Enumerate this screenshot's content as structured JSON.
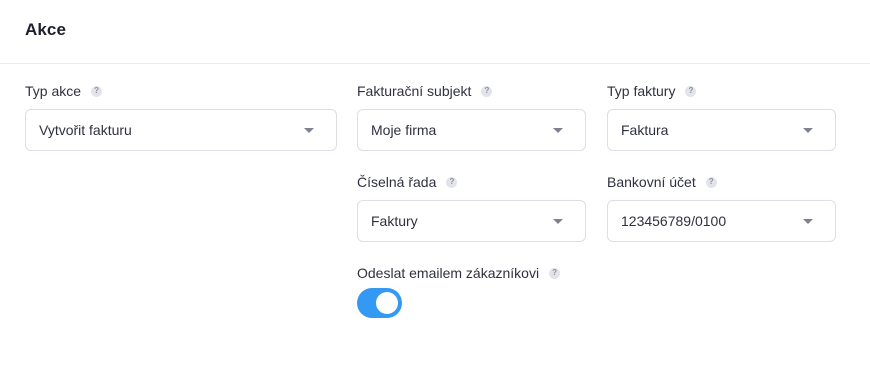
{
  "header": {
    "title": "Akce"
  },
  "fields": {
    "typ_akce": {
      "label": "Typ akce",
      "value": "Vytvořit fakturu",
      "help": "?"
    },
    "fakturacni_subjekt": {
      "label": "Fakturační subjekt",
      "value": "Moje firma",
      "help": "?"
    },
    "typ_faktury": {
      "label": "Typ faktury",
      "value": "Faktura",
      "help": "?"
    },
    "ciselna_rada": {
      "label": "Číselná řada",
      "value": "Faktury",
      "help": "?"
    },
    "bankovni_ucet": {
      "label": "Bankovní účet",
      "value": "123456789/0100",
      "help": "?"
    },
    "odeslat_emailem": {
      "label": "Odeslat emailem zákazníkovi",
      "enabled": true,
      "help": "?"
    }
  },
  "colors": {
    "toggle_on": "#3399f3",
    "border": "#dcdfe6",
    "text": "#2f3140"
  }
}
